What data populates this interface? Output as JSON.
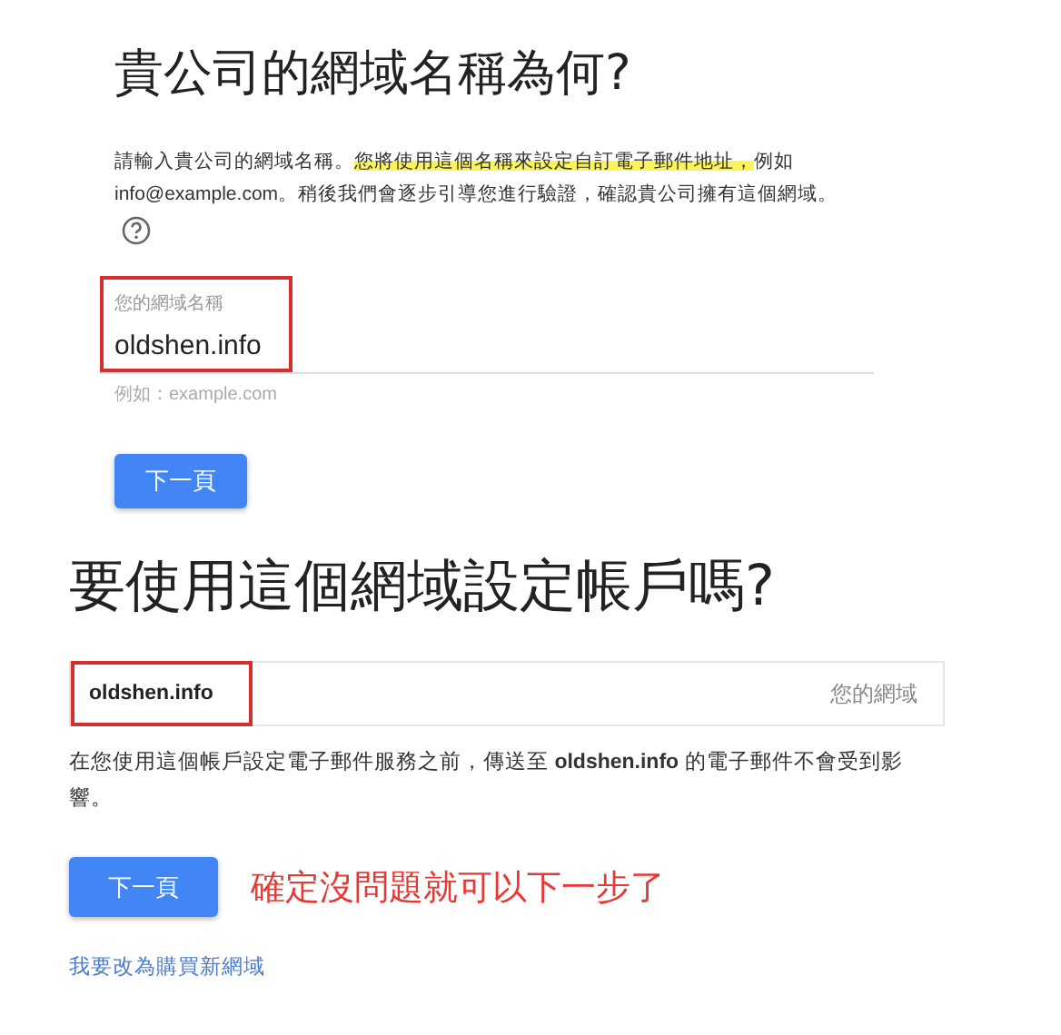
{
  "domain_step": {
    "title": "貴公司的網域名稱為何?",
    "description": [
      {
        "text": "請輸入貴公司的網域名稱。",
        "highlighted": false
      },
      {
        "text": "您將使用這個名稱來設定自訂電子郵件地址，",
        "highlighted": true
      },
      {
        "text": "例如 info@example.com。稍後我們會逐步引導您進行驗證，確認貴公司擁有這個網域。",
        "highlighted": false
      }
    ],
    "field": {
      "label": "您的網域名稱",
      "value": "oldshen.info",
      "annotated": true
    },
    "hint": "例如：example.com",
    "button": "下一頁"
  },
  "confirm_step": {
    "title": "要使用這個網域設定帳戶嗎?",
    "domain": {
      "value": "oldshen.info",
      "label": "您的網域",
      "annotated": true
    },
    "note": "在您使用這個帳戶設定電子郵件服務之前，傳送至 **oldshen.info** 的電子郵件不會受到影響。",
    "button": "下一頁",
    "annotation": "確定沒問題就可以下一步了",
    "link": "我要改為購買新網域"
  }
}
